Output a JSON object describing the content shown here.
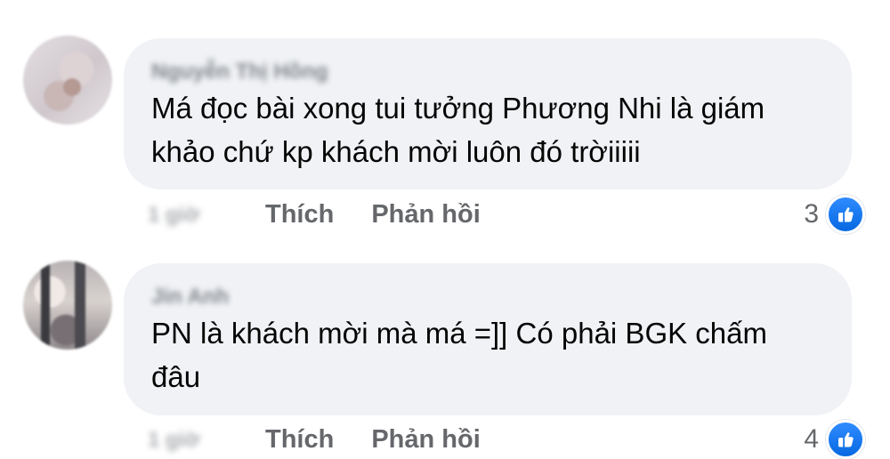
{
  "comments": [
    {
      "author": "Nguyễn Thị Hồng",
      "text": "Má đọc bài xong tui tưởng Phương Nhi là giám\nkhảo chứ kp khách mời luôn đó trờiiiii",
      "time": "1 giờ",
      "like_label": "Thích",
      "reply_label": "Phản hồi",
      "reaction_count": "3",
      "reaction_icon": "thumbs-up-icon",
      "reaction_color": "#1877f2"
    },
    {
      "author": "Jin Anh",
      "text": "PN là khách mời mà má =]] Có phải BGK chấm\nđâu",
      "time": "1 giờ",
      "like_label": "Thích",
      "reply_label": "Phản hồi",
      "reaction_count": "4",
      "reaction_icon": "thumbs-up-icon",
      "reaction_color": "#1877f2"
    }
  ]
}
